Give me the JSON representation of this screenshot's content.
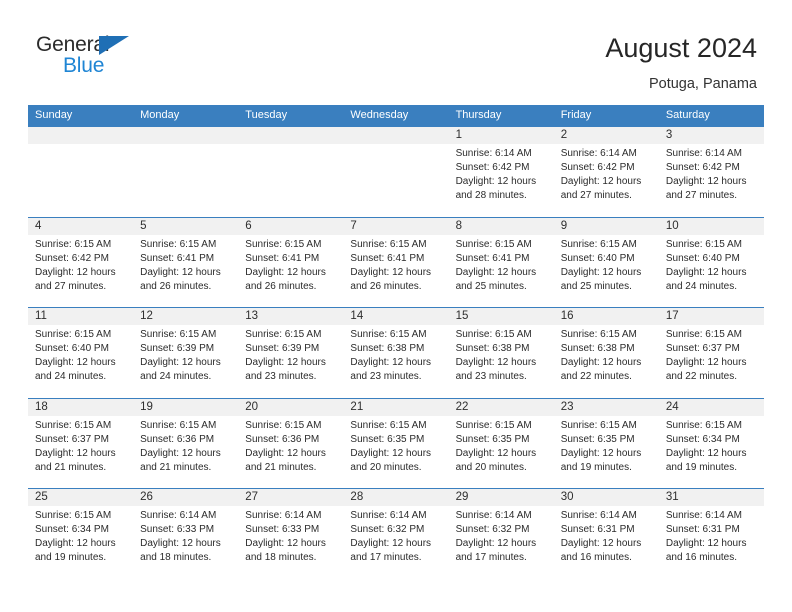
{
  "logo": {
    "word_top": "General",
    "word_bottom": "Blue",
    "triangle_color": "#1f6fb5",
    "blue_text_color": "#1f85d4"
  },
  "header": {
    "title": "August 2024",
    "location": "Potuga, Panama"
  },
  "theme": {
    "header_bg": "#3a7fbf",
    "daynum_bg": "#f1f1f1",
    "row_border": "#3a7fbf",
    "text": "#2b2b2b"
  },
  "weekdays": [
    "Sunday",
    "Monday",
    "Tuesday",
    "Wednesday",
    "Thursday",
    "Friday",
    "Saturday"
  ],
  "weeks": [
    [
      {
        "day": "",
        "empty": true,
        "sunrise": "",
        "sunset": "",
        "daylight1": "",
        "daylight2": ""
      },
      {
        "day": "",
        "empty": true,
        "sunrise": "",
        "sunset": "",
        "daylight1": "",
        "daylight2": ""
      },
      {
        "day": "",
        "empty": true,
        "sunrise": "",
        "sunset": "",
        "daylight1": "",
        "daylight2": ""
      },
      {
        "day": "",
        "empty": true,
        "sunrise": "",
        "sunset": "",
        "daylight1": "",
        "daylight2": ""
      },
      {
        "day": "1",
        "sunrise": "Sunrise: 6:14 AM",
        "sunset": "Sunset: 6:42 PM",
        "daylight1": "Daylight: 12 hours",
        "daylight2": "and 28 minutes."
      },
      {
        "day": "2",
        "sunrise": "Sunrise: 6:14 AM",
        "sunset": "Sunset: 6:42 PM",
        "daylight1": "Daylight: 12 hours",
        "daylight2": "and 27 minutes."
      },
      {
        "day": "3",
        "sunrise": "Sunrise: 6:14 AM",
        "sunset": "Sunset: 6:42 PM",
        "daylight1": "Daylight: 12 hours",
        "daylight2": "and 27 minutes."
      }
    ],
    [
      {
        "day": "4",
        "sunrise": "Sunrise: 6:15 AM",
        "sunset": "Sunset: 6:42 PM",
        "daylight1": "Daylight: 12 hours",
        "daylight2": "and 27 minutes."
      },
      {
        "day": "5",
        "sunrise": "Sunrise: 6:15 AM",
        "sunset": "Sunset: 6:41 PM",
        "daylight1": "Daylight: 12 hours",
        "daylight2": "and 26 minutes."
      },
      {
        "day": "6",
        "sunrise": "Sunrise: 6:15 AM",
        "sunset": "Sunset: 6:41 PM",
        "daylight1": "Daylight: 12 hours",
        "daylight2": "and 26 minutes."
      },
      {
        "day": "7",
        "sunrise": "Sunrise: 6:15 AM",
        "sunset": "Sunset: 6:41 PM",
        "daylight1": "Daylight: 12 hours",
        "daylight2": "and 26 minutes."
      },
      {
        "day": "8",
        "sunrise": "Sunrise: 6:15 AM",
        "sunset": "Sunset: 6:41 PM",
        "daylight1": "Daylight: 12 hours",
        "daylight2": "and 25 minutes."
      },
      {
        "day": "9",
        "sunrise": "Sunrise: 6:15 AM",
        "sunset": "Sunset: 6:40 PM",
        "daylight1": "Daylight: 12 hours",
        "daylight2": "and 25 minutes."
      },
      {
        "day": "10",
        "sunrise": "Sunrise: 6:15 AM",
        "sunset": "Sunset: 6:40 PM",
        "daylight1": "Daylight: 12 hours",
        "daylight2": "and 24 minutes."
      }
    ],
    [
      {
        "day": "11",
        "sunrise": "Sunrise: 6:15 AM",
        "sunset": "Sunset: 6:40 PM",
        "daylight1": "Daylight: 12 hours",
        "daylight2": "and 24 minutes."
      },
      {
        "day": "12",
        "sunrise": "Sunrise: 6:15 AM",
        "sunset": "Sunset: 6:39 PM",
        "daylight1": "Daylight: 12 hours",
        "daylight2": "and 24 minutes."
      },
      {
        "day": "13",
        "sunrise": "Sunrise: 6:15 AM",
        "sunset": "Sunset: 6:39 PM",
        "daylight1": "Daylight: 12 hours",
        "daylight2": "and 23 minutes."
      },
      {
        "day": "14",
        "sunrise": "Sunrise: 6:15 AM",
        "sunset": "Sunset: 6:38 PM",
        "daylight1": "Daylight: 12 hours",
        "daylight2": "and 23 minutes."
      },
      {
        "day": "15",
        "sunrise": "Sunrise: 6:15 AM",
        "sunset": "Sunset: 6:38 PM",
        "daylight1": "Daylight: 12 hours",
        "daylight2": "and 23 minutes."
      },
      {
        "day": "16",
        "sunrise": "Sunrise: 6:15 AM",
        "sunset": "Sunset: 6:38 PM",
        "daylight1": "Daylight: 12 hours",
        "daylight2": "and 22 minutes."
      },
      {
        "day": "17",
        "sunrise": "Sunrise: 6:15 AM",
        "sunset": "Sunset: 6:37 PM",
        "daylight1": "Daylight: 12 hours",
        "daylight2": "and 22 minutes."
      }
    ],
    [
      {
        "day": "18",
        "sunrise": "Sunrise: 6:15 AM",
        "sunset": "Sunset: 6:37 PM",
        "daylight1": "Daylight: 12 hours",
        "daylight2": "and 21 minutes."
      },
      {
        "day": "19",
        "sunrise": "Sunrise: 6:15 AM",
        "sunset": "Sunset: 6:36 PM",
        "daylight1": "Daylight: 12 hours",
        "daylight2": "and 21 minutes."
      },
      {
        "day": "20",
        "sunrise": "Sunrise: 6:15 AM",
        "sunset": "Sunset: 6:36 PM",
        "daylight1": "Daylight: 12 hours",
        "daylight2": "and 21 minutes."
      },
      {
        "day": "21",
        "sunrise": "Sunrise: 6:15 AM",
        "sunset": "Sunset: 6:35 PM",
        "daylight1": "Daylight: 12 hours",
        "daylight2": "and 20 minutes."
      },
      {
        "day": "22",
        "sunrise": "Sunrise: 6:15 AM",
        "sunset": "Sunset: 6:35 PM",
        "daylight1": "Daylight: 12 hours",
        "daylight2": "and 20 minutes."
      },
      {
        "day": "23",
        "sunrise": "Sunrise: 6:15 AM",
        "sunset": "Sunset: 6:35 PM",
        "daylight1": "Daylight: 12 hours",
        "daylight2": "and 19 minutes."
      },
      {
        "day": "24",
        "sunrise": "Sunrise: 6:15 AM",
        "sunset": "Sunset: 6:34 PM",
        "daylight1": "Daylight: 12 hours",
        "daylight2": "and 19 minutes."
      }
    ],
    [
      {
        "day": "25",
        "sunrise": "Sunrise: 6:15 AM",
        "sunset": "Sunset: 6:34 PM",
        "daylight1": "Daylight: 12 hours",
        "daylight2": "and 19 minutes."
      },
      {
        "day": "26",
        "sunrise": "Sunrise: 6:14 AM",
        "sunset": "Sunset: 6:33 PM",
        "daylight1": "Daylight: 12 hours",
        "daylight2": "and 18 minutes."
      },
      {
        "day": "27",
        "sunrise": "Sunrise: 6:14 AM",
        "sunset": "Sunset: 6:33 PM",
        "daylight1": "Daylight: 12 hours",
        "daylight2": "and 18 minutes."
      },
      {
        "day": "28",
        "sunrise": "Sunrise: 6:14 AM",
        "sunset": "Sunset: 6:32 PM",
        "daylight1": "Daylight: 12 hours",
        "daylight2": "and 17 minutes."
      },
      {
        "day": "29",
        "sunrise": "Sunrise: 6:14 AM",
        "sunset": "Sunset: 6:32 PM",
        "daylight1": "Daylight: 12 hours",
        "daylight2": "and 17 minutes."
      },
      {
        "day": "30",
        "sunrise": "Sunrise: 6:14 AM",
        "sunset": "Sunset: 6:31 PM",
        "daylight1": "Daylight: 12 hours",
        "daylight2": "and 16 minutes."
      },
      {
        "day": "31",
        "sunrise": "Sunrise: 6:14 AM",
        "sunset": "Sunset: 6:31 PM",
        "daylight1": "Daylight: 12 hours",
        "daylight2": "and 16 minutes."
      }
    ]
  ]
}
